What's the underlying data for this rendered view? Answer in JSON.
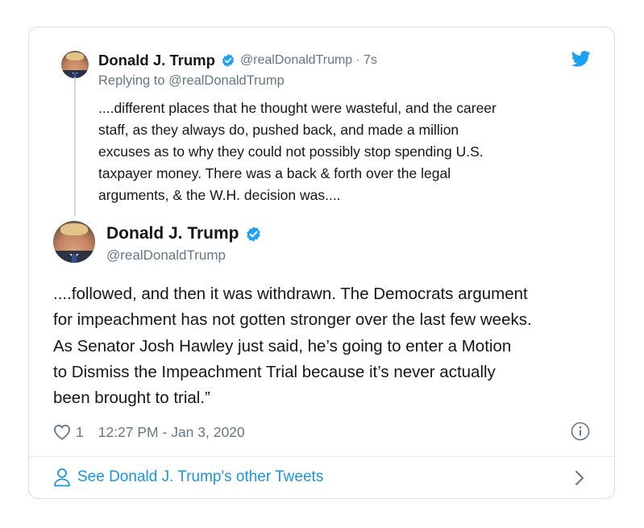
{
  "reply_tweet": {
    "author_name": "Donald J. Trump",
    "handle": "@realDonaldTrump",
    "time_ago": "· 7s",
    "replying_to_prefix": "Replying to",
    "replying_to_handle": "@realDonaldTrump",
    "lines": [
      "....different places that he thought were wasteful, and the career",
      "staff, as they always do, pushed back, and made a million",
      "excuses as to why they could not possibly stop spending U.S.",
      "taxpayer money. There was a back & forth over the legal",
      "arguments, & the W.H. decision was...."
    ]
  },
  "main_tweet": {
    "author_name": "Donald J. Trump",
    "handle": "@realDonaldTrump",
    "lines": [
      "....followed, and then it was withdrawn. The Democrats argument",
      "for impeachment has not gotten stronger over the last few weeks.",
      "As Senator Josh Hawley just said, he’s going to enter a Motion",
      "to Dismiss the Impeachment Trial because it’s never actually",
      "been brought to trial.”"
    ],
    "like_count": "1",
    "timestamp": "12:27 PM - Jan 3, 2020"
  },
  "footer": {
    "see_tweets_label": "See Donald J. Trump's other Tweets"
  },
  "icons": {
    "verified": "verified-badge-icon",
    "twitter": "twitter-bird-icon",
    "like": "heart-icon",
    "info": "info-icon",
    "person": "person-icon",
    "chevron": "chevron-right-icon"
  },
  "colors": {
    "accent": "#1da1f2",
    "link": "#1b95e0",
    "muted": "#657786",
    "text": "#14171a"
  }
}
